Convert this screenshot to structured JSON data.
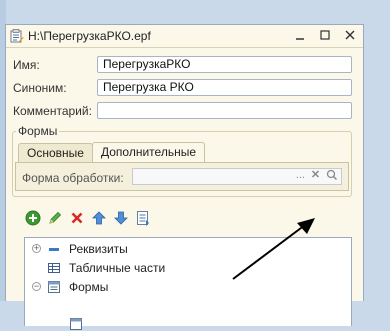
{
  "window": {
    "title": "H:\\ПерегрузкаРКО.epf"
  },
  "fields": {
    "name_label": "Имя:",
    "name_value": "ПерегрузкаРКО",
    "synonym_label": "Синоним:",
    "synonym_value": "Перегрузка РКО",
    "comment_label": "Комментарий:",
    "comment_value": ""
  },
  "forms_group": {
    "title": "Формы",
    "tabs": [
      {
        "label": "Основные",
        "active": false
      },
      {
        "label": "Дополнительные",
        "active": true
      }
    ],
    "processing_form_label": "Форма обработки:",
    "processing_form_value": "",
    "select_button": "...",
    "clear_button": "✕"
  },
  "toolbar": {
    "icons": [
      "add-icon",
      "edit-icon",
      "delete-icon",
      "move-up-icon",
      "move-down-icon",
      "sort-icon"
    ]
  },
  "tree": {
    "items": [
      {
        "label": "Реквизиты",
        "expander": "+",
        "icon": "attributes-icon"
      },
      {
        "label": "Табличные части",
        "expander": "",
        "icon": "table-icon"
      },
      {
        "label": "Формы",
        "expander": "−",
        "icon": "forms-icon"
      }
    ]
  },
  "colors": {
    "window_bg": "#fbf8e9",
    "desktop_bg": "#c9d9ea",
    "field_border": "#a9b4c4",
    "accent_green": "#3a9a2f",
    "accent_red": "#d42a2a",
    "accent_blue": "#3b78c7"
  }
}
